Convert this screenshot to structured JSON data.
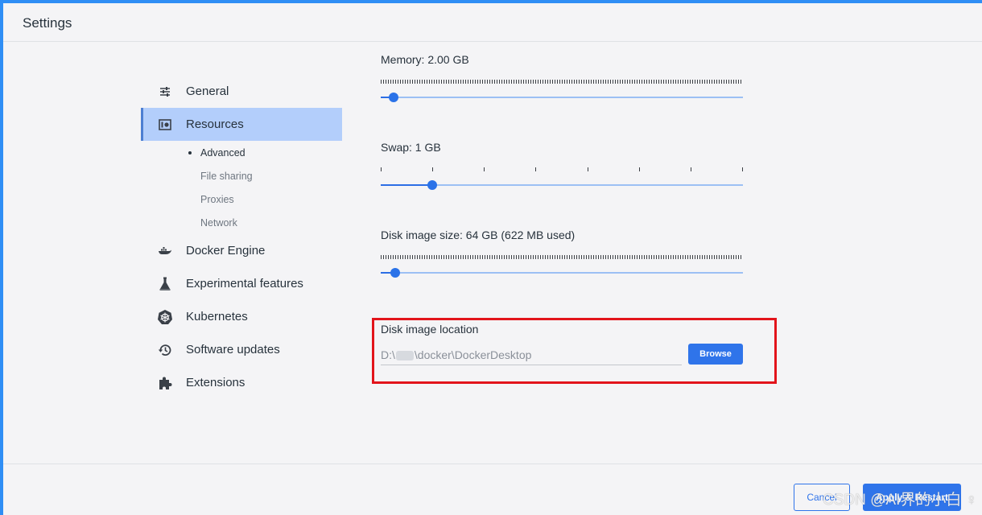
{
  "header": {
    "title": "Settings"
  },
  "sidebar": {
    "items": [
      {
        "label": "General",
        "icon": "sliders-icon"
      },
      {
        "label": "Resources",
        "icon": "resources-icon",
        "active": true,
        "sub_items": [
          "Advanced",
          "File sharing",
          "Proxies",
          "Network"
        ]
      },
      {
        "label": "Docker Engine",
        "icon": "whale-icon"
      },
      {
        "label": "Experimental features",
        "icon": "flask-icon"
      },
      {
        "label": "Kubernetes",
        "icon": "helm-icon"
      },
      {
        "label": "Software updates",
        "icon": "history-icon"
      },
      {
        "label": "Extensions",
        "icon": "puzzle-icon"
      }
    ]
  },
  "main": {
    "memory": {
      "label": "Memory: 2.00 GB",
      "value_fraction": 0.035
    },
    "swap": {
      "label": "Swap: 1 GB",
      "value_fraction": 0.143,
      "ticks": 8
    },
    "disk_size": {
      "label": "Disk image size: 64 GB (622 MB used)",
      "value_fraction": 0.04
    },
    "disk_location": {
      "label": "Disk image location",
      "path_prefix": "D:\\",
      "path_suffix": "\\docker\\DockerDesktop",
      "browse_label": "Browse"
    }
  },
  "footer": {
    "cancel_label": "Cancel",
    "apply_label": "Apply & Restart"
  },
  "watermark": "CSDN @AI界的小白 ♀",
  "colors": {
    "accent": "#2f74ea",
    "active_nav": "#b3cefb",
    "highlight": "#e2141b"
  }
}
